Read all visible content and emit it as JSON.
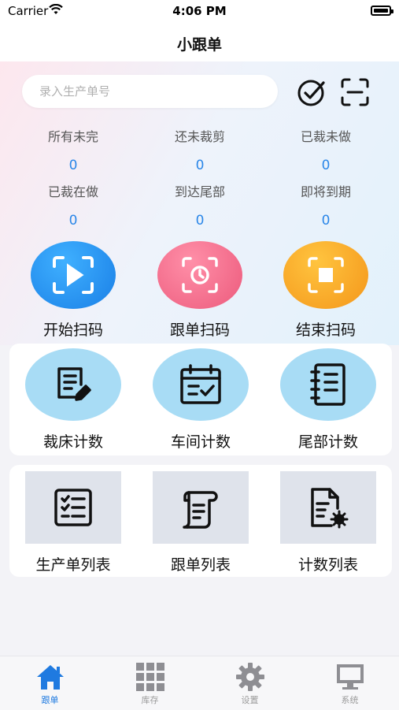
{
  "status_bar": {
    "carrier": "Carrier",
    "time": "4:06 PM"
  },
  "nav": {
    "title": "小跟单"
  },
  "search": {
    "placeholder": "录入生产单号"
  },
  "stats": [
    {
      "label": "所有未完",
      "value": "0"
    },
    {
      "label": "还未裁剪",
      "value": "0"
    },
    {
      "label": "已裁未做",
      "value": "0"
    },
    {
      "label": "已裁在做",
      "value": "0"
    },
    {
      "label": "到达尾部",
      "value": "0"
    },
    {
      "label": "即将到期",
      "value": "0"
    }
  ],
  "scan_buttons": [
    {
      "label": "开始扫码",
      "icon": "play-scan-icon",
      "color": "#1e8df0"
    },
    {
      "label": "跟单扫码",
      "icon": "clock-scan-icon",
      "color": "#f26a8a"
    },
    {
      "label": "结束扫码",
      "icon": "stop-scan-icon",
      "color": "#f7a21d"
    }
  ],
  "count_tiles": [
    {
      "label": "裁床计数",
      "icon": "document-edit-icon"
    },
    {
      "label": "车间计数",
      "icon": "calendar-check-icon"
    },
    {
      "label": "尾部计数",
      "icon": "notebook-icon"
    }
  ],
  "list_tiles": [
    {
      "label": "生产单列表",
      "icon": "checklist-icon"
    },
    {
      "label": "跟单列表",
      "icon": "scroll-icon"
    },
    {
      "label": "计数列表",
      "icon": "document-gear-icon"
    }
  ],
  "tabs": [
    {
      "label": "跟单",
      "icon": "home-icon",
      "active": true
    },
    {
      "label": "库存",
      "icon": "grid-icon",
      "active": false
    },
    {
      "label": "设置",
      "icon": "gear-icon",
      "active": false
    },
    {
      "label": "系统",
      "icon": "monitor-icon",
      "active": false
    }
  ],
  "colors": {
    "accent": "#1f7ae0",
    "stat_value": "#2a86e8",
    "tile_bg": "#a8dcf5"
  }
}
